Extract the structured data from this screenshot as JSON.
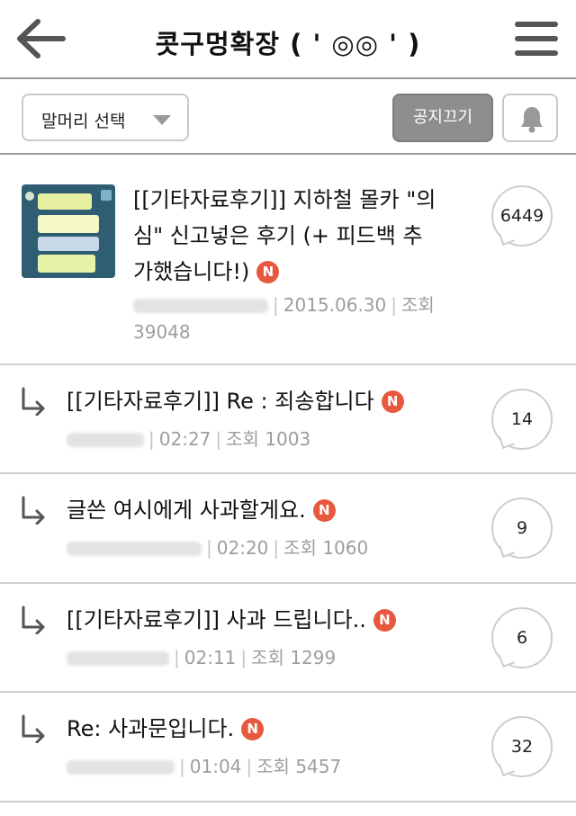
{
  "header": {
    "title": "콧구멍확장 ( ' ◎◎ ' )",
    "back_icon": "arrow-left-icon",
    "menu_icon": "hamburger-menu-icon"
  },
  "toolbar": {
    "select_label": "말머리 선택",
    "notice_button": "공지끄기",
    "bell_icon": "bell-icon"
  },
  "posts": [
    {
      "title": "[[기타자료후기]] 지하철 몰카 \"의심\" 신고넣은 후기 (+ 피드백 추가했습니다!)",
      "title_line1": "[[기타자료후기]] 지하철 몰카 \"의",
      "title_line2": "심\" 신고넣은 후기 (+ 피드백 추",
      "title_line3": "가했습니다!)",
      "badge": "N",
      "date": "2015.06.30",
      "views_label": "조회",
      "views": "39048",
      "comments": "6449"
    },
    {
      "title": "[[기타자료후기]] Re : 죄송합니다",
      "badge": "N",
      "date": "02:27",
      "views_label": "조회",
      "views": "1003",
      "comments": "14"
    },
    {
      "title": "글쓴 여시에게 사과할게요.",
      "badge": "N",
      "date": "02:20",
      "views_label": "조회",
      "views": "1060",
      "comments": "9"
    },
    {
      "title": "[[기타자료후기]] 사과 드립니다..",
      "badge": "N",
      "date": "02:11",
      "views_label": "조회",
      "views": "1299",
      "comments": "6"
    },
    {
      "title": "Re: 사과문입니다.",
      "badge": "N",
      "date": "01:04",
      "views_label": "조회",
      "views": "5457",
      "comments": "32"
    }
  ],
  "colors": {
    "badge": "#e8583e",
    "notice_button": "#8e8e8e",
    "meta_text": "#9e9e9e",
    "divider": "#cfcfcf"
  }
}
